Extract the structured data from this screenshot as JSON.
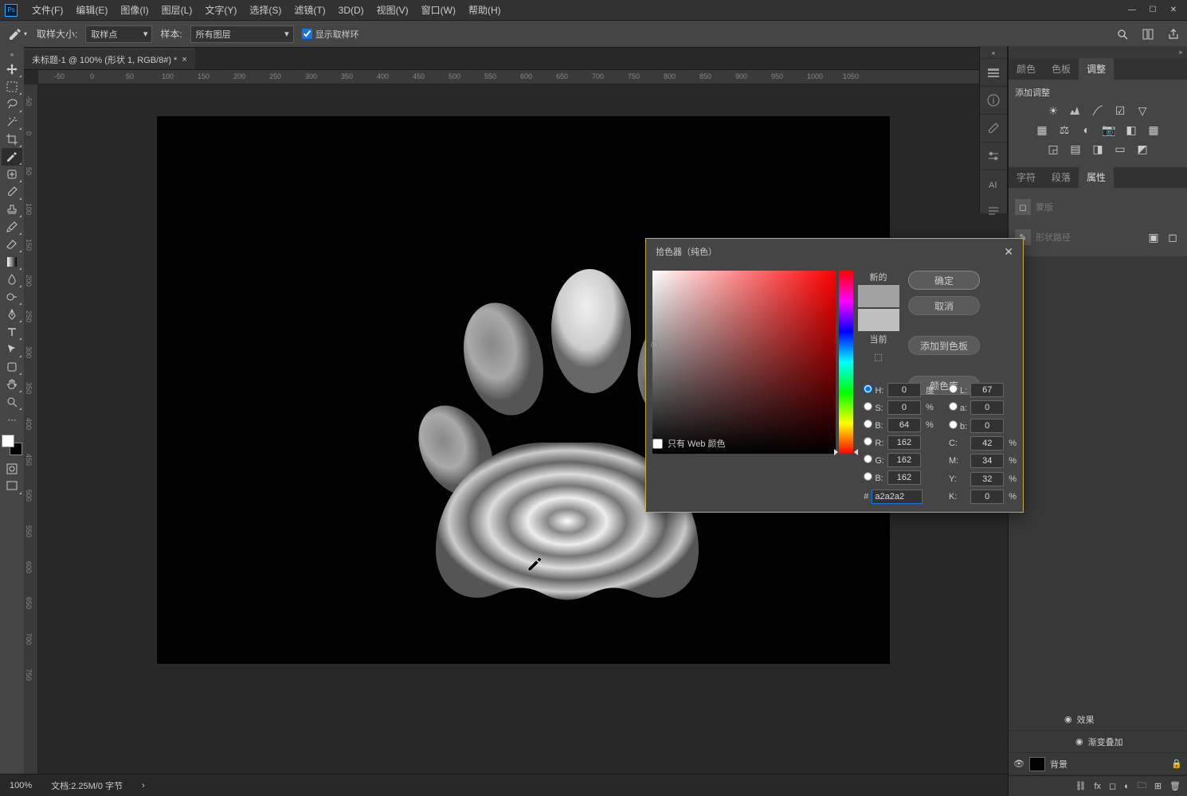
{
  "menubar": {
    "items": [
      "文件(F)",
      "编辑(E)",
      "图像(I)",
      "图层(L)",
      "文字(Y)",
      "选择(S)",
      "滤镜(T)",
      "3D(D)",
      "视图(V)",
      "窗口(W)",
      "帮助(H)"
    ]
  },
  "window_controls": {
    "min": "—",
    "max": "☐",
    "close": "✕"
  },
  "optionbar": {
    "sample_size_label": "取样大小:",
    "sample_size_value": "取样点",
    "sample_label": "样本:",
    "sample_value": "所有图层",
    "show_ring_label": "显示取样环",
    "show_ring_checked": true
  },
  "document_tab": {
    "title": "未标题-1 @ 100% (形状 1, RGB/8#) *"
  },
  "ruler_h": [
    -50,
    0,
    50,
    100,
    150,
    200,
    250,
    300,
    350,
    400,
    450,
    500,
    550,
    600,
    650,
    700,
    750,
    800,
    850,
    900,
    950,
    1000,
    1050
  ],
  "ruler_v": [
    -50,
    0,
    50,
    100,
    150,
    200,
    250,
    300,
    350,
    400,
    450,
    500,
    550,
    600,
    650,
    700,
    750
  ],
  "statusbar": {
    "zoom": "100%",
    "doc": "文档:2.25M/0 字节"
  },
  "panels": {
    "top_tabs": [
      "颜色",
      "色板",
      "调整"
    ],
    "adj_title": "添加调整",
    "mid_tabs": [
      "字符",
      "段落",
      "属性"
    ],
    "mask_label": "蒙版",
    "shape_label": "形状路径"
  },
  "layers": {
    "fx": "效果",
    "grad": "渐变叠加",
    "bg": "背景"
  },
  "colorpicker": {
    "title": "拾色器（纯色）",
    "new_label": "新的",
    "cur_label": "当前",
    "ok": "确定",
    "cancel": "取消",
    "add_swatch": "添加到色板",
    "color_lib": "颜色库",
    "web_only": "只有 Web 颜色",
    "H": {
      "label": "H:",
      "val": "0",
      "unit": "度"
    },
    "S": {
      "label": "S:",
      "val": "0",
      "unit": "%"
    },
    "Bv": {
      "label": "B:",
      "val": "64",
      "unit": "%"
    },
    "R": {
      "label": "R:",
      "val": "162"
    },
    "G": {
      "label": "G:",
      "val": "162"
    },
    "B": {
      "label": "B:",
      "val": "162"
    },
    "L": {
      "label": "L:",
      "val": "67"
    },
    "a": {
      "label": "a:",
      "val": "0"
    },
    "bb": {
      "label": "b:",
      "val": "0"
    },
    "C": {
      "label": "C:",
      "val": "42",
      "unit": "%"
    },
    "M": {
      "label": "M:",
      "val": "34",
      "unit": "%"
    },
    "Y": {
      "label": "Y:",
      "val": "32",
      "unit": "%"
    },
    "K": {
      "label": "K:",
      "val": "0",
      "unit": "%"
    },
    "hex_label": "#",
    "hex": "a2a2a2"
  },
  "colors": {
    "fg": "#ffffff",
    "bg": "#000000",
    "new": "#a2a2a2",
    "cur": "#bfbfbf"
  }
}
